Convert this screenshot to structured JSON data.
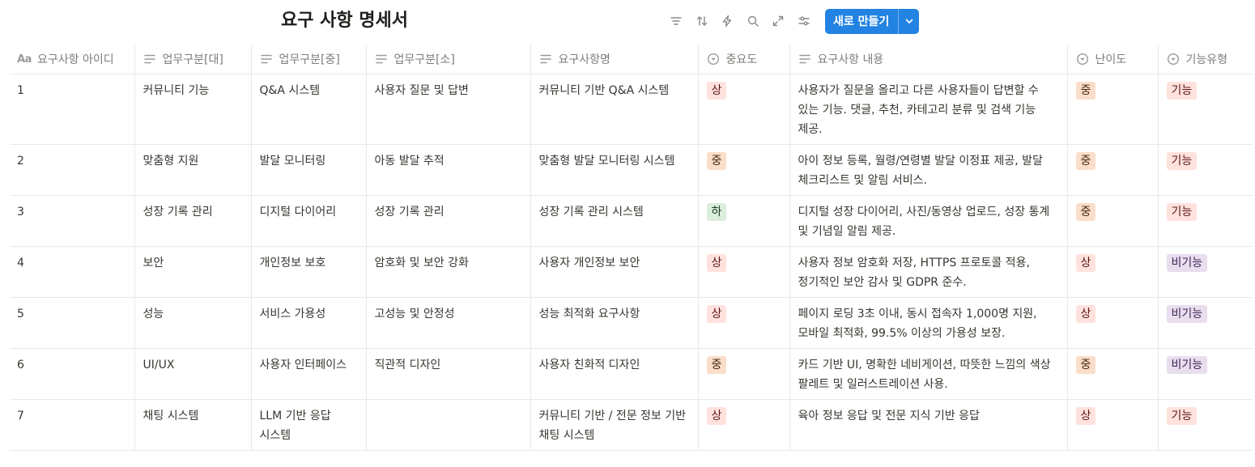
{
  "page": {
    "title": "요구 사항 명세서"
  },
  "toolbar": {
    "icons": [
      "filter-icon",
      "sort-icon",
      "lightning-icon",
      "search-icon",
      "expand-icon",
      "settings-sliders-icon"
    ],
    "new_button_label": "새로 만들기"
  },
  "columns": [
    {
      "key": "id",
      "label": "요구사항 아이디",
      "icon": "title-aa-icon"
    },
    {
      "key": "cat_l",
      "label": "업무구분[대]",
      "icon": "text-lines-icon"
    },
    {
      "key": "cat_m",
      "label": "업무구분[중]",
      "icon": "text-lines-icon"
    },
    {
      "key": "cat_s",
      "label": "업무구분[소]",
      "icon": "text-lines-icon"
    },
    {
      "key": "name",
      "label": "요구사항명",
      "icon": "text-lines-icon"
    },
    {
      "key": "priority",
      "label": "중요도",
      "icon": "select-icon"
    },
    {
      "key": "desc",
      "label": "요구사항 내용",
      "icon": "text-lines-icon"
    },
    {
      "key": "difficulty",
      "label": "난이도",
      "icon": "select-icon"
    },
    {
      "key": "type",
      "label": "기능유형",
      "icon": "select-icon"
    }
  ],
  "tag_colors": {
    "상": {
      "bg": "#ffe2dd",
      "fg": "#5d1715"
    },
    "중": {
      "bg": "#fadec9",
      "fg": "#49290e"
    },
    "하": {
      "bg": "#dbeddb",
      "fg": "#1c3829"
    },
    "기능": {
      "bg": "#ffe2dd",
      "fg": "#5d1715"
    },
    "비기능": {
      "bg": "#e8deee",
      "fg": "#412454"
    }
  },
  "rows": [
    {
      "id": "1",
      "cat_l": "커뮤니티 기능",
      "cat_m": "Q&A 시스템",
      "cat_s": "사용자 질문 및 답변",
      "name": "커뮤니티 기반 Q&A 시스템",
      "priority": "상",
      "desc": "사용자가 질문을 올리고 다른 사용자들이 답변할 수 있는 기능. 댓글, 추천, 카테고리 분류 및 검색 기능 제공.",
      "difficulty": "중",
      "type": "기능"
    },
    {
      "id": "2",
      "cat_l": "맞춤형 지원",
      "cat_m": "발달 모니터링",
      "cat_s": "아동 발달 추적",
      "name": "맞춤형 발달 모니터링 시스템",
      "priority": "중",
      "desc": "아이 정보 등록, 월령/연령별 발달 이정표 제공, 발달 체크리스트 및 알림 서비스.",
      "difficulty": "중",
      "type": "기능"
    },
    {
      "id": "3",
      "cat_l": "성장 기록 관리",
      "cat_m": "디지털 다이어리",
      "cat_s": "성장 기록 관리",
      "name": "성장 기록 관리 시스템",
      "priority": "하",
      "desc": "디지털 성장 다이어리, 사진/동영상 업로드, 성장 통계 및 기념일 알림 제공.",
      "difficulty": "중",
      "type": "기능"
    },
    {
      "id": "4",
      "cat_l": "보안",
      "cat_m": "개인정보 보호",
      "cat_s": "암호화 및 보안 강화",
      "name": "사용자 개인정보 보안",
      "priority": "상",
      "desc": "사용자 정보 암호화 저장, HTTPS 프로토콜 적용, 정기적인 보안 감사 및 GDPR 준수.",
      "difficulty": "상",
      "type": "비기능"
    },
    {
      "id": "5",
      "cat_l": "성능",
      "cat_m": "서비스 가용성",
      "cat_s": "고성능 및 안정성",
      "name": "성능 최적화 요구사항",
      "priority": "상",
      "desc": "페이지 로딩 3초 이내, 동시 접속자 1,000명 지원, 모바일 최적화, 99.5% 이상의 가용성 보장.",
      "difficulty": "상",
      "type": "비기능"
    },
    {
      "id": "6",
      "cat_l": "UI/UX",
      "cat_m": "사용자 인터페이스",
      "cat_s": "직관적 디자인",
      "name": "사용자 친화적 디자인",
      "priority": "중",
      "desc": "카드 기반 UI, 명확한 네비게이션, 따뜻한 느낌의 색상 팔레트 및 일러스트레이션 사용.",
      "difficulty": "중",
      "type": "비기능"
    },
    {
      "id": "7",
      "cat_l": "채팅 시스템",
      "cat_m": "LLM 기반 응답 시스템",
      "cat_s": "",
      "name": "커뮤니티 기반 / 전문 정보 기반 채팅 시스템",
      "priority": "상",
      "desc": "육아 정보 응답 및 전문 지식 기반 응답",
      "difficulty": "상",
      "type": "기능"
    }
  ]
}
